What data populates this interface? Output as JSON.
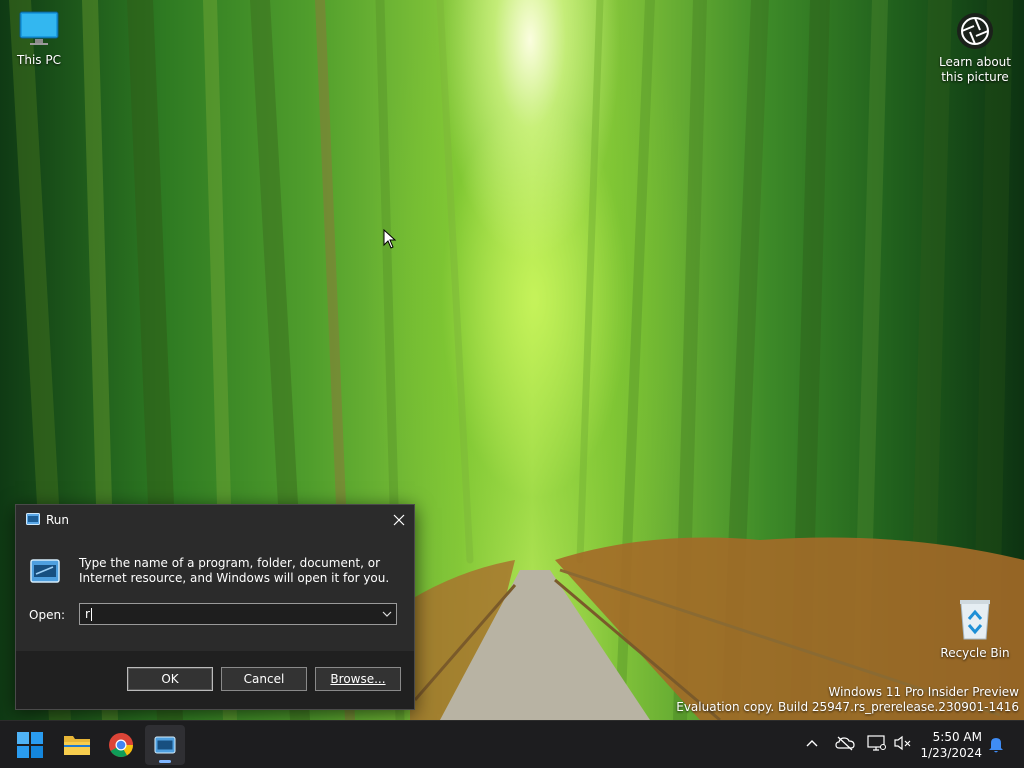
{
  "desktop": {
    "icons": [
      {
        "label": "This PC",
        "icon": "monitor-icon"
      },
      {
        "label": "Learn about this picture",
        "line1": "Learn about",
        "line2": "this picture",
        "icon": "camera-lens-icon"
      },
      {
        "label": "Recycle Bin",
        "icon": "recycle-bin-icon"
      }
    ],
    "watermark": {
      "line1": "Windows 11 Pro Insider Preview",
      "line2": "Evaluation copy. Build 25947.rs_prerelease.230901-1416"
    }
  },
  "run_dialog": {
    "title": "Run",
    "description": "Type the name of a program, folder, document, or Internet resource, and Windows will open it for you.",
    "open_label": "Open:",
    "open_value": "r",
    "buttons": {
      "ok": "OK",
      "cancel": "Cancel",
      "browse": "Browse..."
    }
  },
  "taskbar": {
    "apps": [
      {
        "name": "Start",
        "icon": "windows-start-icon"
      },
      {
        "name": "File Explorer",
        "icon": "folder-icon"
      },
      {
        "name": "Google Chrome",
        "icon": "chrome-icon"
      },
      {
        "name": "Run",
        "icon": "run-icon",
        "active": true
      }
    ],
    "tray": {
      "icons": [
        "chevron-up-icon",
        "onedrive-icon",
        "network-icon",
        "volume-muted-icon",
        "notification-bell-icon"
      ]
    },
    "clock": {
      "time": "5:50 AM",
      "date": "1/23/2024"
    }
  },
  "colors": {
    "taskbar": "#1d1d1f",
    "dialog": "#2b2b2b",
    "dialog_footer": "#202020",
    "accent": "#7fb6ff"
  }
}
